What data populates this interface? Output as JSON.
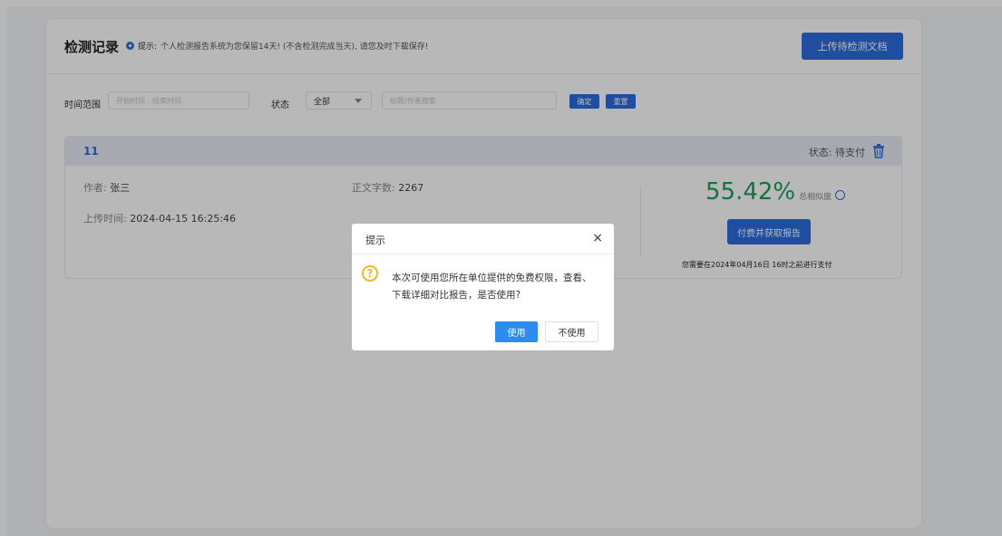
{
  "header": {
    "title": "检测记录",
    "tip_label": "提示:",
    "tip_text": "个人检测报告系统为您保留14天! (不含检测完成当天), 请您及时下载保存!",
    "upload_button": "上传待检测文档"
  },
  "filter": {
    "time_label": "时间范围",
    "time_placeholder": "开始时间 - 结束时间",
    "status_label": "状态",
    "status_value": "全部",
    "search_placeholder": "标题/作者搜索",
    "confirm_button": "确定",
    "reset_button": "重置"
  },
  "record": {
    "id": "11",
    "status": "状态: 待支付",
    "author_label": "作者:",
    "author": "张三",
    "word_count_label": "正文字数:",
    "word_count": "2267",
    "upload_time_label": "上传时间:",
    "upload_time": "2024-04-15 16:25:46",
    "similarity": "55.42%",
    "similarity_label": "总相似度",
    "pay_button": "付费并获取报告",
    "pay_deadline": "您需要在2024年04月16日 16时之前进行支付"
  },
  "dialog": {
    "title": "提示",
    "close": "×",
    "icon": "?",
    "message": "本次可使用您所在单位提供的免费权限，查看、下载详细对比报告，是否使用?",
    "confirm": "使用",
    "cancel": "不使用"
  },
  "colors": {
    "primary": "#2b6de0",
    "success": "#1aa05a",
    "warning": "#f4b620"
  }
}
